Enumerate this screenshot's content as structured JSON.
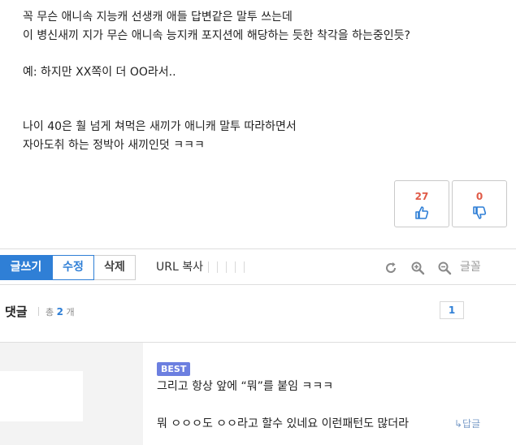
{
  "post": {
    "lines": [
      "꼭 무슨 애니속 지능캐 선생캐 애들 답변같은 말투 쓰는데",
      "이 병신새끼 지가 무슨 애니속 능지캐 포지션에 해당하는 듯한 착각을 하는중인듯?",
      "",
      "예: 하지만 XX쪽이 더 OO라서..",
      "",
      "",
      "나이 40은 훨 넘게 쳐먹은 새끼가 애니캐 말투 따라하면서",
      "자아도취 하는 정박아 새끼인덧 ㅋㅋㅋ"
    ]
  },
  "votes": {
    "up": {
      "count": "27",
      "icon": "thumbs-up-icon"
    },
    "down": {
      "count": "0",
      "icon": "thumbs-down-icon"
    }
  },
  "toolbar": {
    "write_label": "글쓰기",
    "edit_label": "수정",
    "delete_label": "삭제",
    "url_copy_label": "URL 복사",
    "font_label": "글꼴",
    "icons": [
      "refresh-icon",
      "zoom-in-icon",
      "zoom-out-icon"
    ]
  },
  "comments_header": {
    "title": "댓글",
    "total_prefix": "총",
    "total_count": "2",
    "total_suffix": "개",
    "page": "1"
  },
  "comment": {
    "badge": "BEST",
    "line1": "그리고 항상 앞에 “뭐”를 붙임 ㅋㅋㅋ",
    "line2": "뭐 ㅇㅇㅇ도 ㅇㅇ라고 할수 있네요 이런패턴도 많더라",
    "reply_label": "↳답글"
  },
  "colors": {
    "accent": "#2f7fd6",
    "vote_count": "#e05a47",
    "best_badge": "#6c7fe0"
  }
}
